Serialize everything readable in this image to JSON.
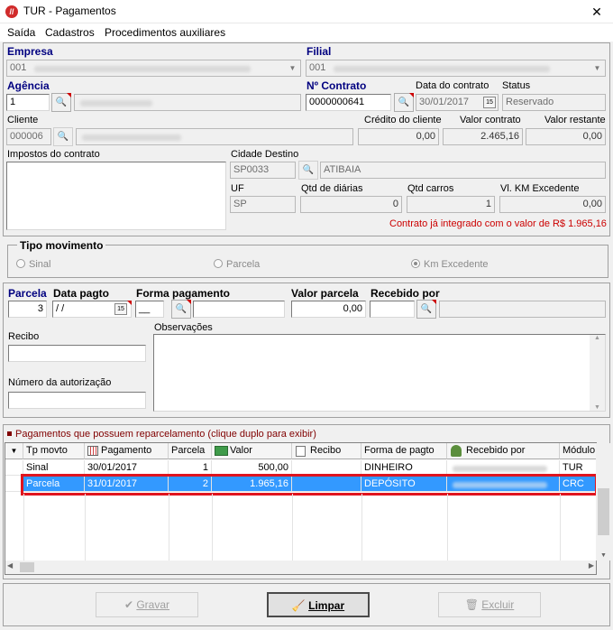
{
  "window": {
    "title": "TUR - Pagamentos",
    "close_glyph": "✕"
  },
  "menu": [
    "Saída",
    "Cadastros",
    "Procedimentos auxiliares"
  ],
  "header": {
    "empresa_label": "Empresa",
    "empresa_value": "001",
    "filial_label": "Filial",
    "filial_value": "001",
    "agencia_label": "Agência",
    "agencia_value": "1",
    "contrato_label": "Nº Contrato",
    "contrato_value": "0000000641",
    "data_contrato_label": "Data do contrato",
    "data_contrato_value": "30/01/2017",
    "status_label": "Status",
    "status_value": "Reservado",
    "cliente_label": "Cliente",
    "cliente_value": "000006",
    "credito_label": "Crédito do cliente",
    "credito_value": "0,00",
    "valor_contrato_label": "Valor contrato",
    "valor_contrato_value": "2.465,16",
    "valor_restante_label": "Valor restante",
    "valor_restante_value": "0,00",
    "impostos_label": "Impostos do contrato",
    "cidade_destino_label": "Cidade Destino",
    "cidade_destino_code": "SP0033",
    "cidade_destino_name": "ATIBAIA",
    "uf_label": "UF",
    "uf_value": "SP",
    "qtd_diarias_label": "Qtd de diárias",
    "qtd_diarias_value": "0",
    "qtd_carros_label": "Qtd carros",
    "qtd_carros_value": "1",
    "km_excedente_label": "Vl. KM Excedente",
    "km_excedente_value": "0,00",
    "aviso": "Contrato já integrado com o valor de R$ 1.965,16"
  },
  "tipo_movimento": {
    "label": "Tipo movimento",
    "options": [
      "Sinal",
      "Parcela",
      "Km Excedente"
    ],
    "selected": "Km Excedente"
  },
  "parcela_form": {
    "parcela_label": "Parcela",
    "parcela_value": "3",
    "data_pagto_label": "Data pagto",
    "data_pagto_value": " / /",
    "forma_label": "Forma pagamento",
    "forma_value": "__",
    "valor_label": "Valor parcela",
    "valor_value": "0,00",
    "recebido_label": "Recebido por",
    "recibo_label": "Recibo",
    "autorizacao_label": "Número da autorização",
    "observacoes_label": "Observações"
  },
  "grid": {
    "caption": "Pagamentos que possuem reparcelamento (clique duplo para exibir)",
    "columns": [
      "Tp movto",
      "Pagamento",
      "Parcela",
      "Valor",
      "Recibo",
      "Forma de pagto",
      "Recebido por",
      "Módulo"
    ],
    "rows": [
      {
        "tp": "Sinal",
        "pagamento": "30/01/2017",
        "parcela": "1",
        "valor": "500,00",
        "recibo": "",
        "forma": "DINHEIRO",
        "modulo": "TUR"
      },
      {
        "tp": "Parcela",
        "pagamento": "31/01/2017",
        "parcela": "2",
        "valor": "1.965,16",
        "recibo": "",
        "forma": "DEPÓSITO",
        "modulo": "CRC"
      }
    ]
  },
  "buttons": {
    "gravar": "Gravar",
    "limpar": "Limpar",
    "excluir": "Excluir"
  },
  "colors": {
    "selection": "#3399ff",
    "highlight_border": "#e0141e",
    "label_blue": "#000080",
    "warning_red": "#cc0000"
  }
}
